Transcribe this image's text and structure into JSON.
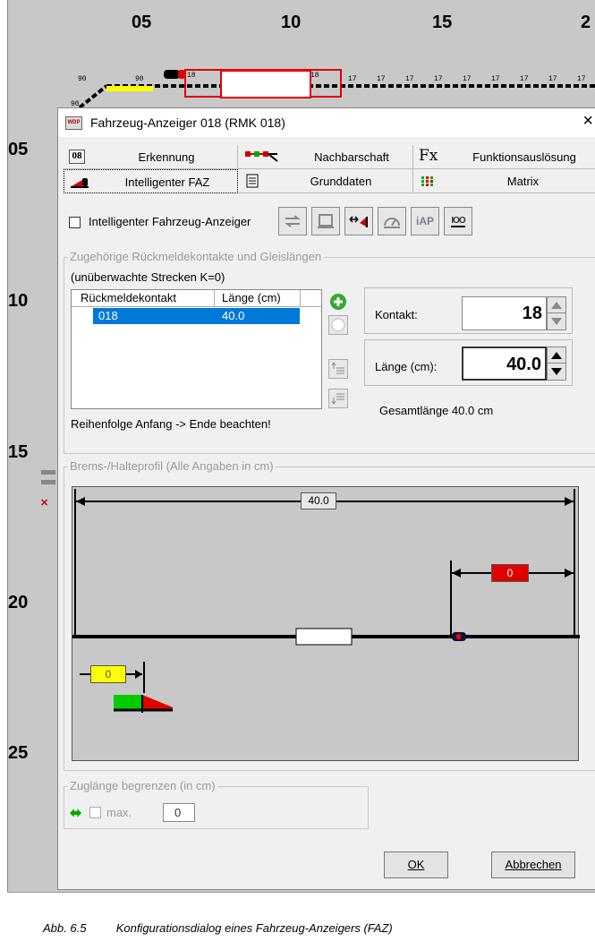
{
  "ruler": {
    "x": [
      "05",
      "10",
      "15",
      "2"
    ],
    "y": [
      "05",
      "10",
      "15",
      "20",
      "25"
    ]
  },
  "track_block_labels": [
    "90",
    "90",
    "18",
    "18",
    "17",
    "17",
    "17",
    "17",
    "17",
    "17",
    "17",
    "17",
    "17",
    "90"
  ],
  "dialog": {
    "title": "Fahrzeug-Anzeiger 018 (RMK 018)",
    "icon_text": "WDP",
    "close": "×"
  },
  "tabs": [
    {
      "icon": "08",
      "label": "Erkennung"
    },
    {
      "icon": "neighbor-icon",
      "label": "Nachbarschaft"
    },
    {
      "icon": "Fx",
      "label": "Funktionsauslösung"
    },
    {
      "icon": "train-icon",
      "label": "Intelligenter FAZ"
    },
    {
      "icon": "document-icon",
      "label": "Grunddaten"
    },
    {
      "icon": "matrix-icon",
      "label": "Matrix"
    }
  ],
  "intelligent_checkbox": {
    "label": "Intelligenter Fahrzeug-Anzeiger",
    "checked": false
  },
  "toolbar_buttons": [
    "swap-arrows-icon",
    "box-icon",
    "direction-red-icon",
    "gauge-icon",
    "iAP",
    "IOO"
  ],
  "contacts_group": {
    "legend": "Zugehörige Rückmeldekontakte und Gleislängen",
    "subtitle": "(unüberwachte Strecken K=0)",
    "columns": [
      "Rückmeldekontakt",
      "Länge (cm)"
    ],
    "rows": [
      {
        "contact": "018",
        "length": "40.0"
      }
    ],
    "hint": "Reihenfolge Anfang -> Ende beachten!",
    "kontakt_label": "Kontakt:",
    "kontakt_value": "18",
    "laenge_label": "Länge (cm):",
    "laenge_value": "40.0",
    "total": "Gesamtlänge 40.0 cm"
  },
  "brake_group": {
    "legend": "Brems-/Halteprofil (Alle Angaben in cm)",
    "total_length": "40.0",
    "right_marker": "0",
    "left_marker": "0"
  },
  "train_length_group": {
    "legend": "Zuglänge begrenzen (in cm)",
    "max_label": "max.",
    "max_value": "0"
  },
  "buttons": {
    "ok": "OK",
    "cancel": "Abbrechen"
  },
  "caption": {
    "number": "Abb. 6.5",
    "text": "Konfigurationsdialog eines Fahrzeug-Anzeigers (FAZ)"
  },
  "colors": {
    "selection": "#0078d7",
    "red_marker": "#e00000",
    "yellow_marker": "#ffff00",
    "green_signal": "#00cc00"
  }
}
